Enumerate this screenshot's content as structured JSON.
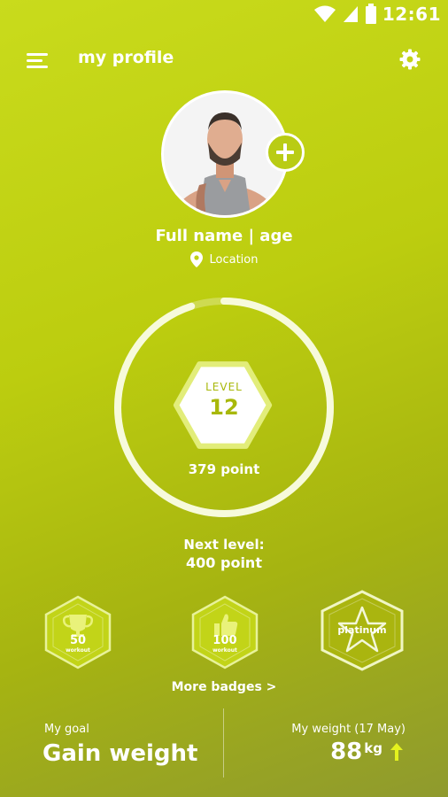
{
  "status_bar": {
    "time": "12:61",
    "icons": [
      "wifi-icon",
      "signal-icon",
      "battery-icon"
    ]
  },
  "header": {
    "title": "my profile",
    "menu_icon": "menu-icon",
    "settings_icon": "gear-icon"
  },
  "profile": {
    "name": "Full name | age",
    "location": "Location",
    "add_photo_icon": "plus-icon"
  },
  "progress": {
    "level_label": "LEVEL",
    "level": "12",
    "points": "379 point",
    "next_level_label": "Next level:",
    "next_level_value": "400 point",
    "fraction": 0.95
  },
  "badges": [
    {
      "number": "50",
      "sub": "workout",
      "icon": "trophy-icon"
    },
    {
      "number": "100",
      "sub": "workout",
      "icon": "thumbs-up-icon"
    },
    {
      "label": "platinum",
      "icon": "star-icon"
    }
  ],
  "more_badges": "More badges >",
  "goal": {
    "label": "My goal",
    "value": "Gain weight"
  },
  "weight": {
    "label": "My weight (17 May)",
    "value": "88",
    "unit": "kg",
    "trend_icon": "arrow-up-icon"
  },
  "colors": {
    "background": "#bccd0f",
    "accent": "#d7ea1a",
    "level_text": "#a8b80a",
    "arrow": "#e4f21e"
  }
}
